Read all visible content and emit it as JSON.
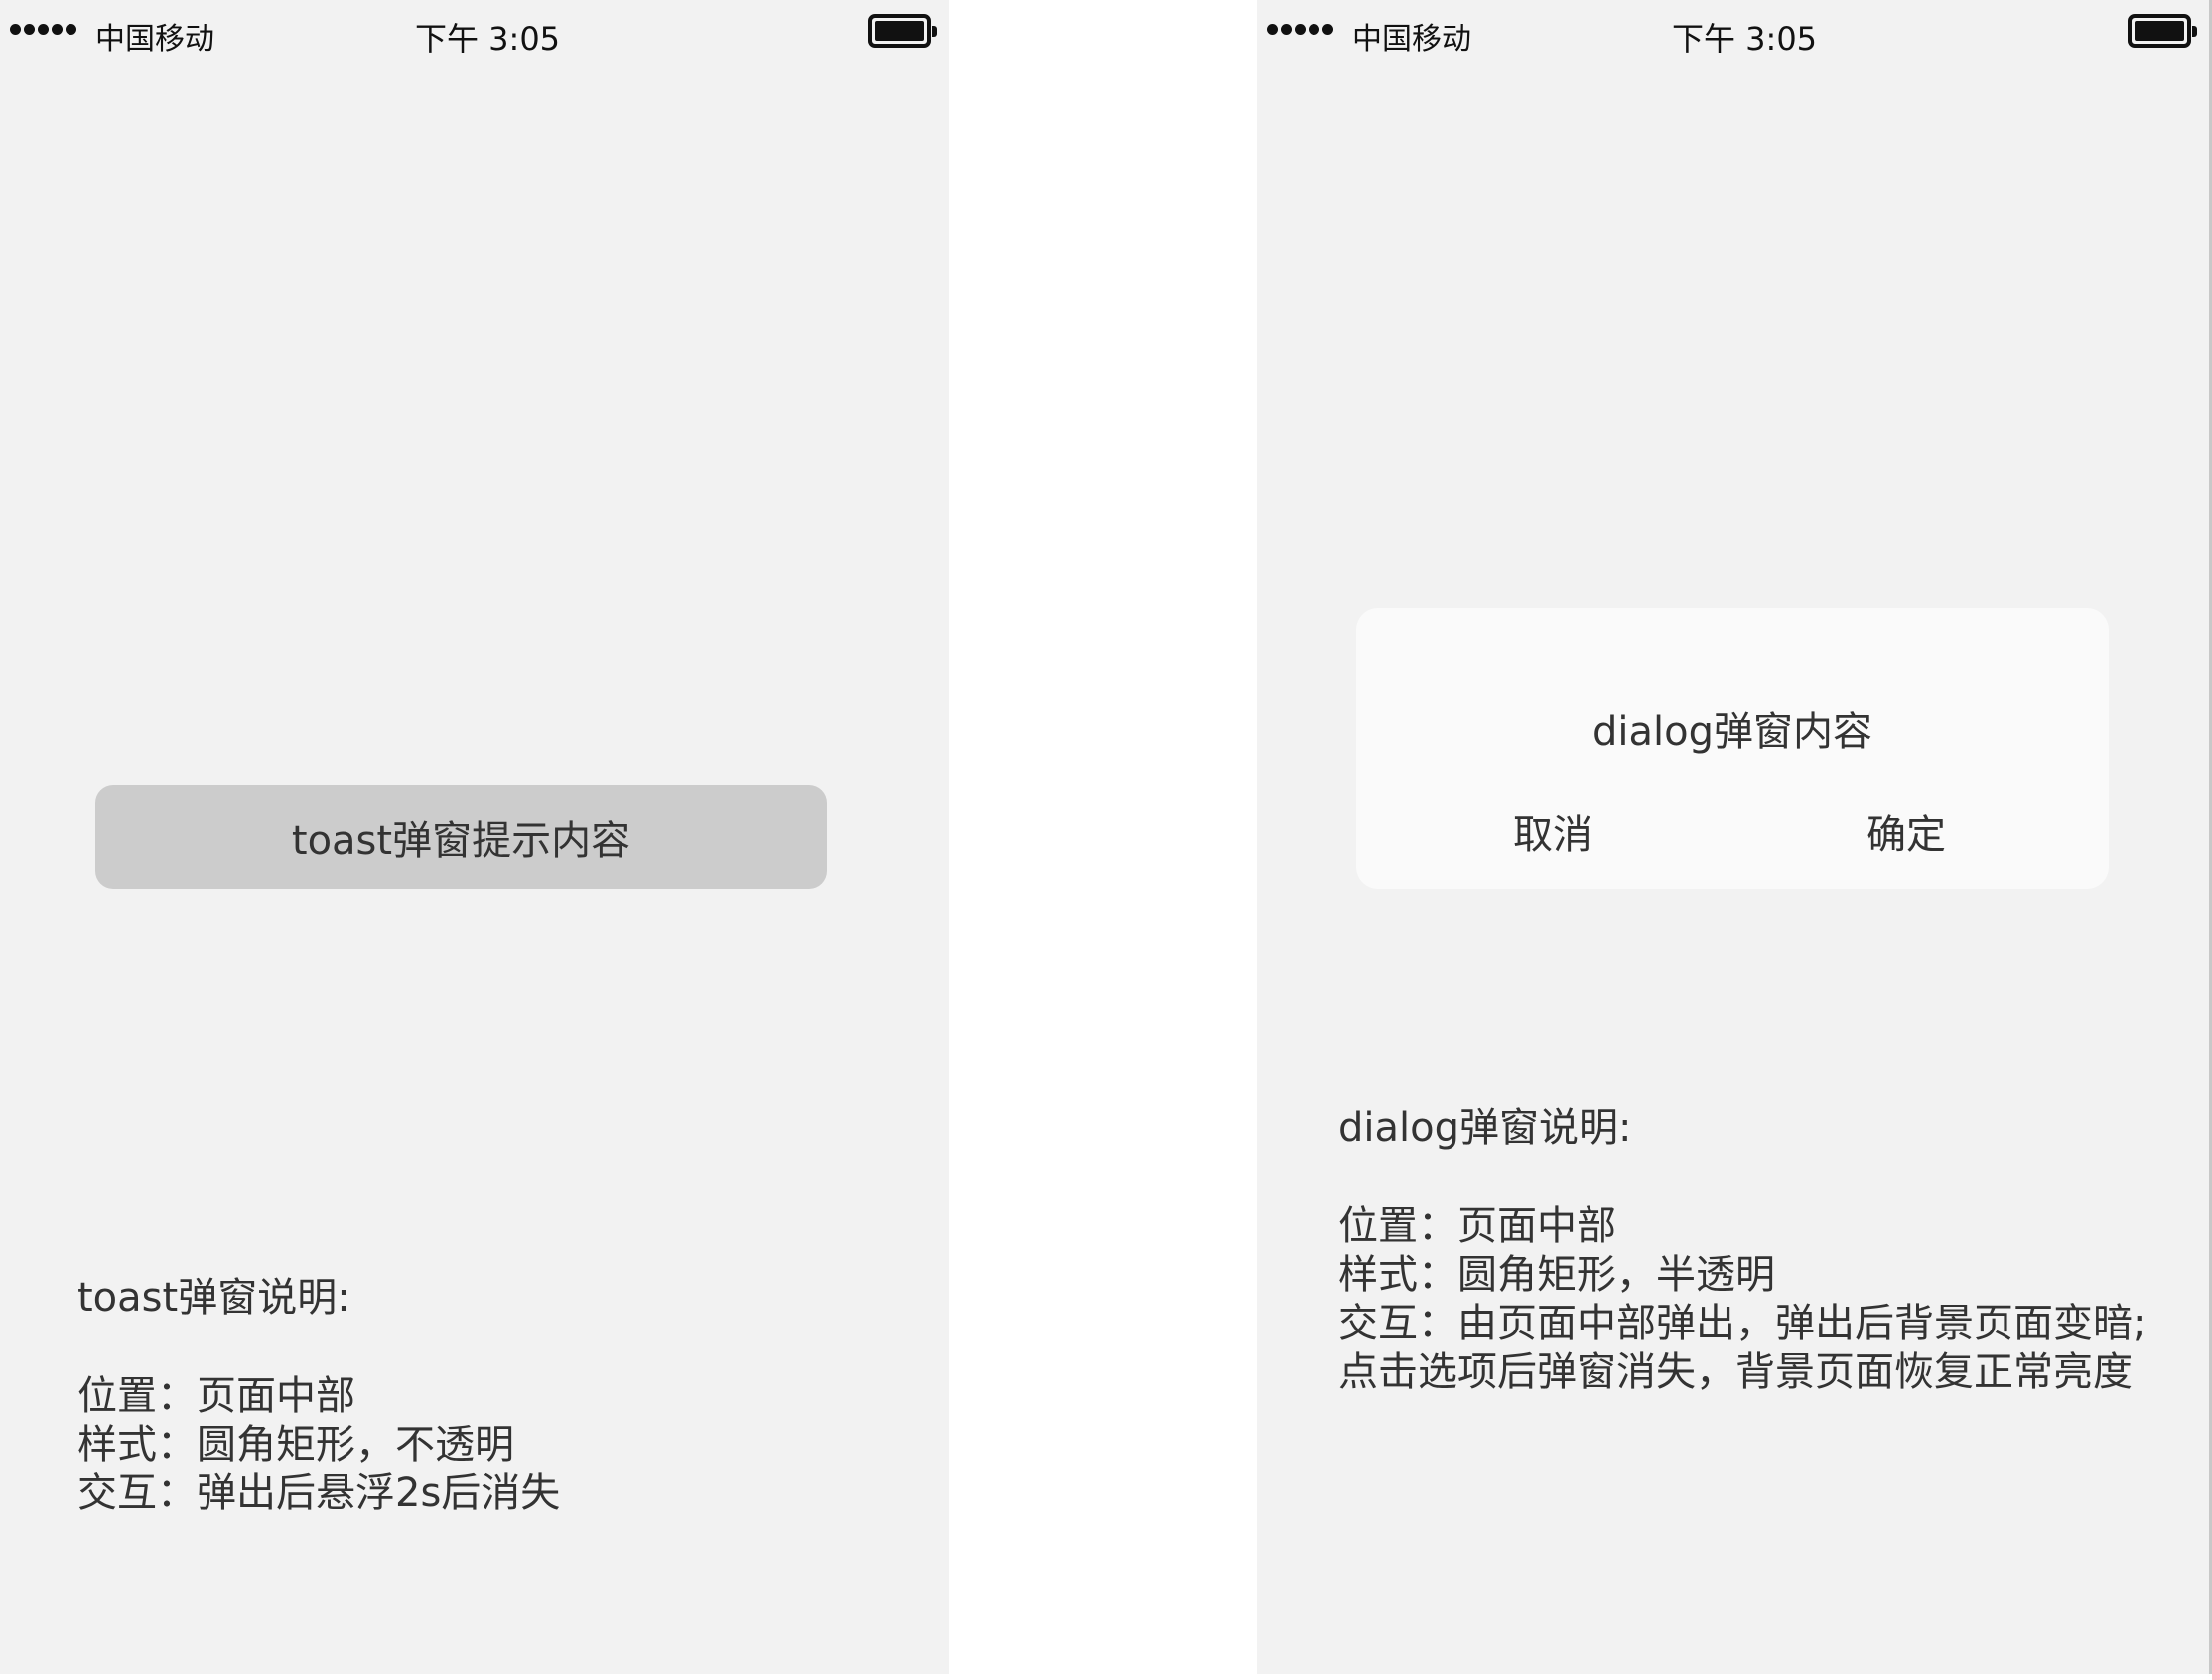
{
  "left_phone": {
    "status": {
      "carrier": "中国移动",
      "time": "下午 3:05",
      "signal_icon": "signal-dots-icon",
      "battery_icon": "battery-full-icon"
    },
    "toast": {
      "text": "toast弹窗提示内容"
    },
    "description": {
      "title": "toast弹窗说明:",
      "lines": [
        "位置：页面中部",
        "样式：圆角矩形，不透明",
        "交互：弹出后悬浮2s后消失"
      ]
    }
  },
  "right_phone": {
    "status": {
      "carrier": "中国移动",
      "time": "下午 3:05",
      "signal_icon": "signal-dots-icon",
      "battery_icon": "battery-full-icon"
    },
    "dialog": {
      "content": "dialog弹窗内容",
      "cancel_label": "取消",
      "confirm_label": "确定"
    },
    "description": {
      "title": "dialog弹窗说明:",
      "lines": [
        "位置：页面中部",
        "样式：圆角矩形，半透明",
        "交互：由页面中部弹出，弹出后背景页面变暗;",
        "点击选项后弹窗消失，背景页面恢复正常亮度"
      ]
    }
  },
  "colors": {
    "screen_background": "#f2f2f2",
    "toast_background": "#cccccc",
    "dialog_background": "#fafafa",
    "text": "#333333"
  }
}
